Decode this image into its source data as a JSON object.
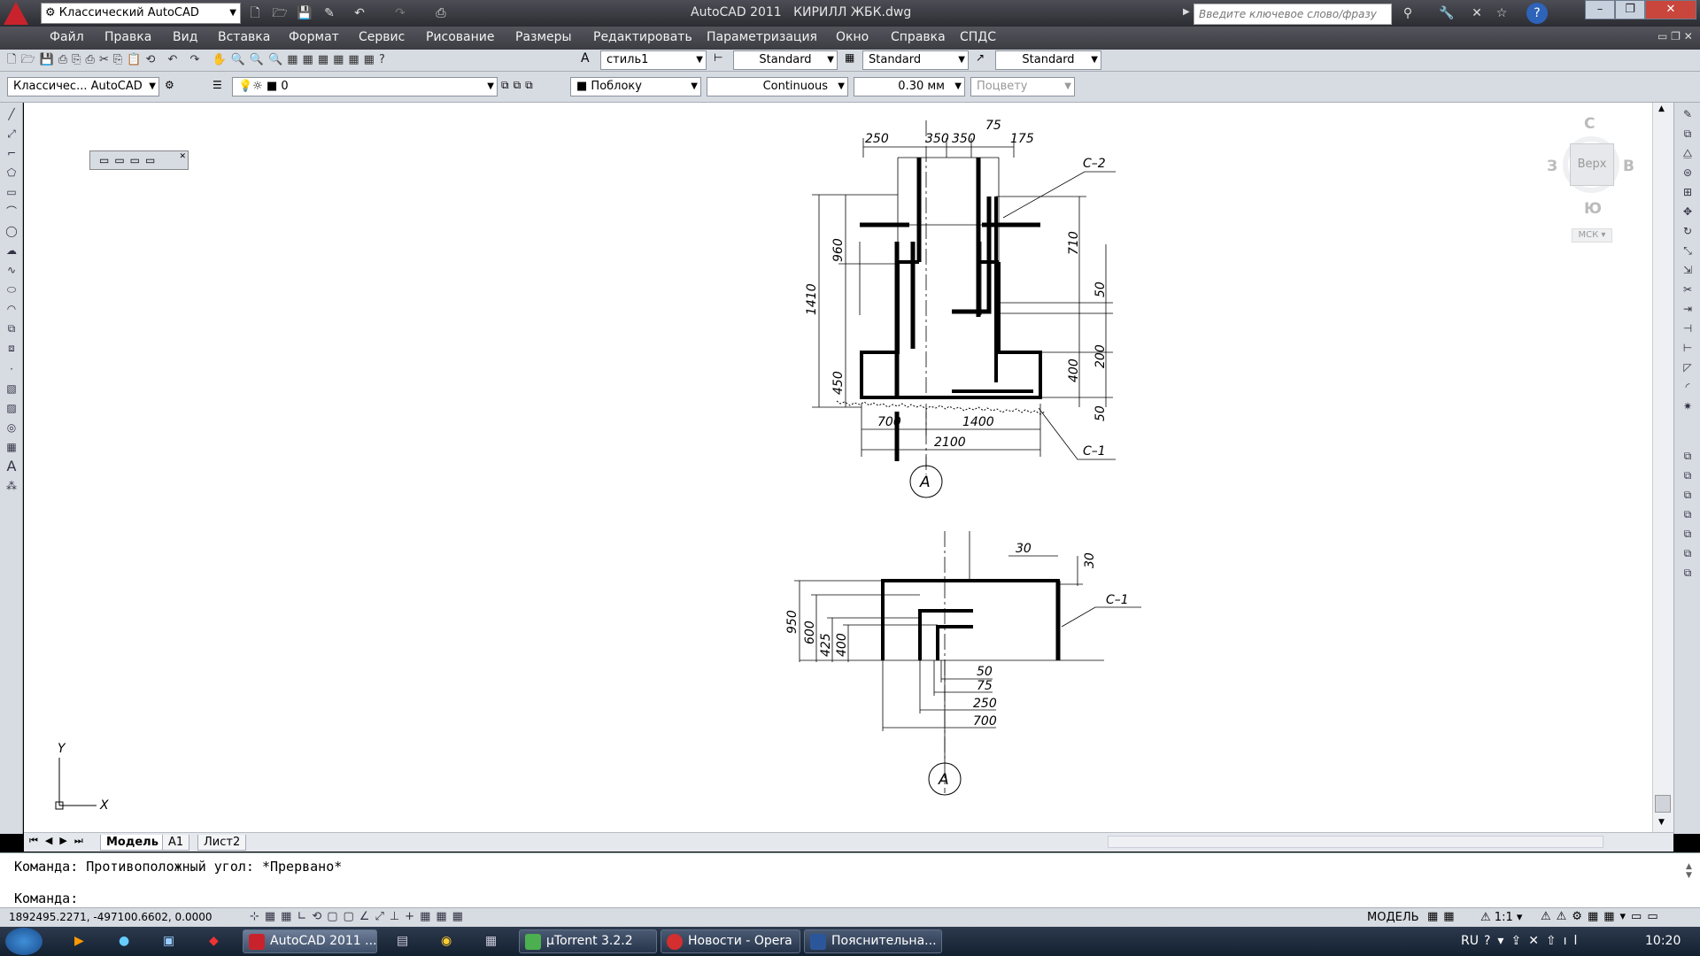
{
  "titlebar": {
    "workspace": "Классический AutoCAD",
    "app_name": "AutoCAD 2011",
    "file_name": "КИРИЛЛ ЖБК.dwg",
    "search_placeholder": "Введите ключевое слово/фразу",
    "help_label": "?"
  },
  "menu": [
    "Файл",
    "Правка",
    "Вид",
    "Вставка",
    "Формат",
    "Сервис",
    "Рисование",
    "Размеры",
    "Редактировать",
    "Параметризация",
    "Окно",
    "Справка",
    "СПДС"
  ],
  "styles": {
    "text_style": "стиль1",
    "dim_style": "Standard",
    "table_style": "Standard",
    "mleader_style": "Standard"
  },
  "layers": {
    "workspace_short": "Классичес... AutoCAD",
    "current_layer": "0",
    "color": "Поблоку",
    "linetype": "Continuous",
    "lineweight": "0.30 мм",
    "plotstyle": "Поцвету"
  },
  "viewcube": {
    "north": "С",
    "south": "Ю",
    "west": "З",
    "east": "В",
    "face": "Верх",
    "ucs": "МСК"
  },
  "ucs_icon": {
    "x": "X",
    "y": "Y"
  },
  "drawing1": {
    "dims_top": [
      "250",
      "350",
      "350",
      "75",
      "175"
    ],
    "dims_left": [
      "1410",
      "960",
      "450"
    ],
    "dims_right": [
      "710",
      "50",
      "200",
      "400",
      "50"
    ],
    "dims_bottom": [
      "700",
      "1400",
      "2100"
    ],
    "leaders": [
      "С–2",
      "С–1"
    ],
    "axis": "А"
  },
  "drawing2": {
    "dims_top": [
      "30",
      "30"
    ],
    "dims_left": [
      "950",
      "600",
      "425",
      "400"
    ],
    "dims_bottom": [
      "50",
      "75",
      "250",
      "700"
    ],
    "leader": "С–1",
    "axis": "А"
  },
  "tabs": [
    "Модель",
    "А1",
    "Лист2"
  ],
  "command": {
    "line1": "Команда: Противоположный угол: *Прервано*",
    "prompt": "Команда:"
  },
  "status": {
    "coords": "1892495.2271, -497100.6602, 0.0000",
    "model": "МОДЕЛЬ",
    "scale": "1:1"
  },
  "taskbar": {
    "tasks": [
      "AutoCAD 2011 ...",
      "µTorrent 3.2.2",
      "Новости - Opera",
      "Пояснительна..."
    ],
    "lang": "RU",
    "time": "10:20"
  }
}
